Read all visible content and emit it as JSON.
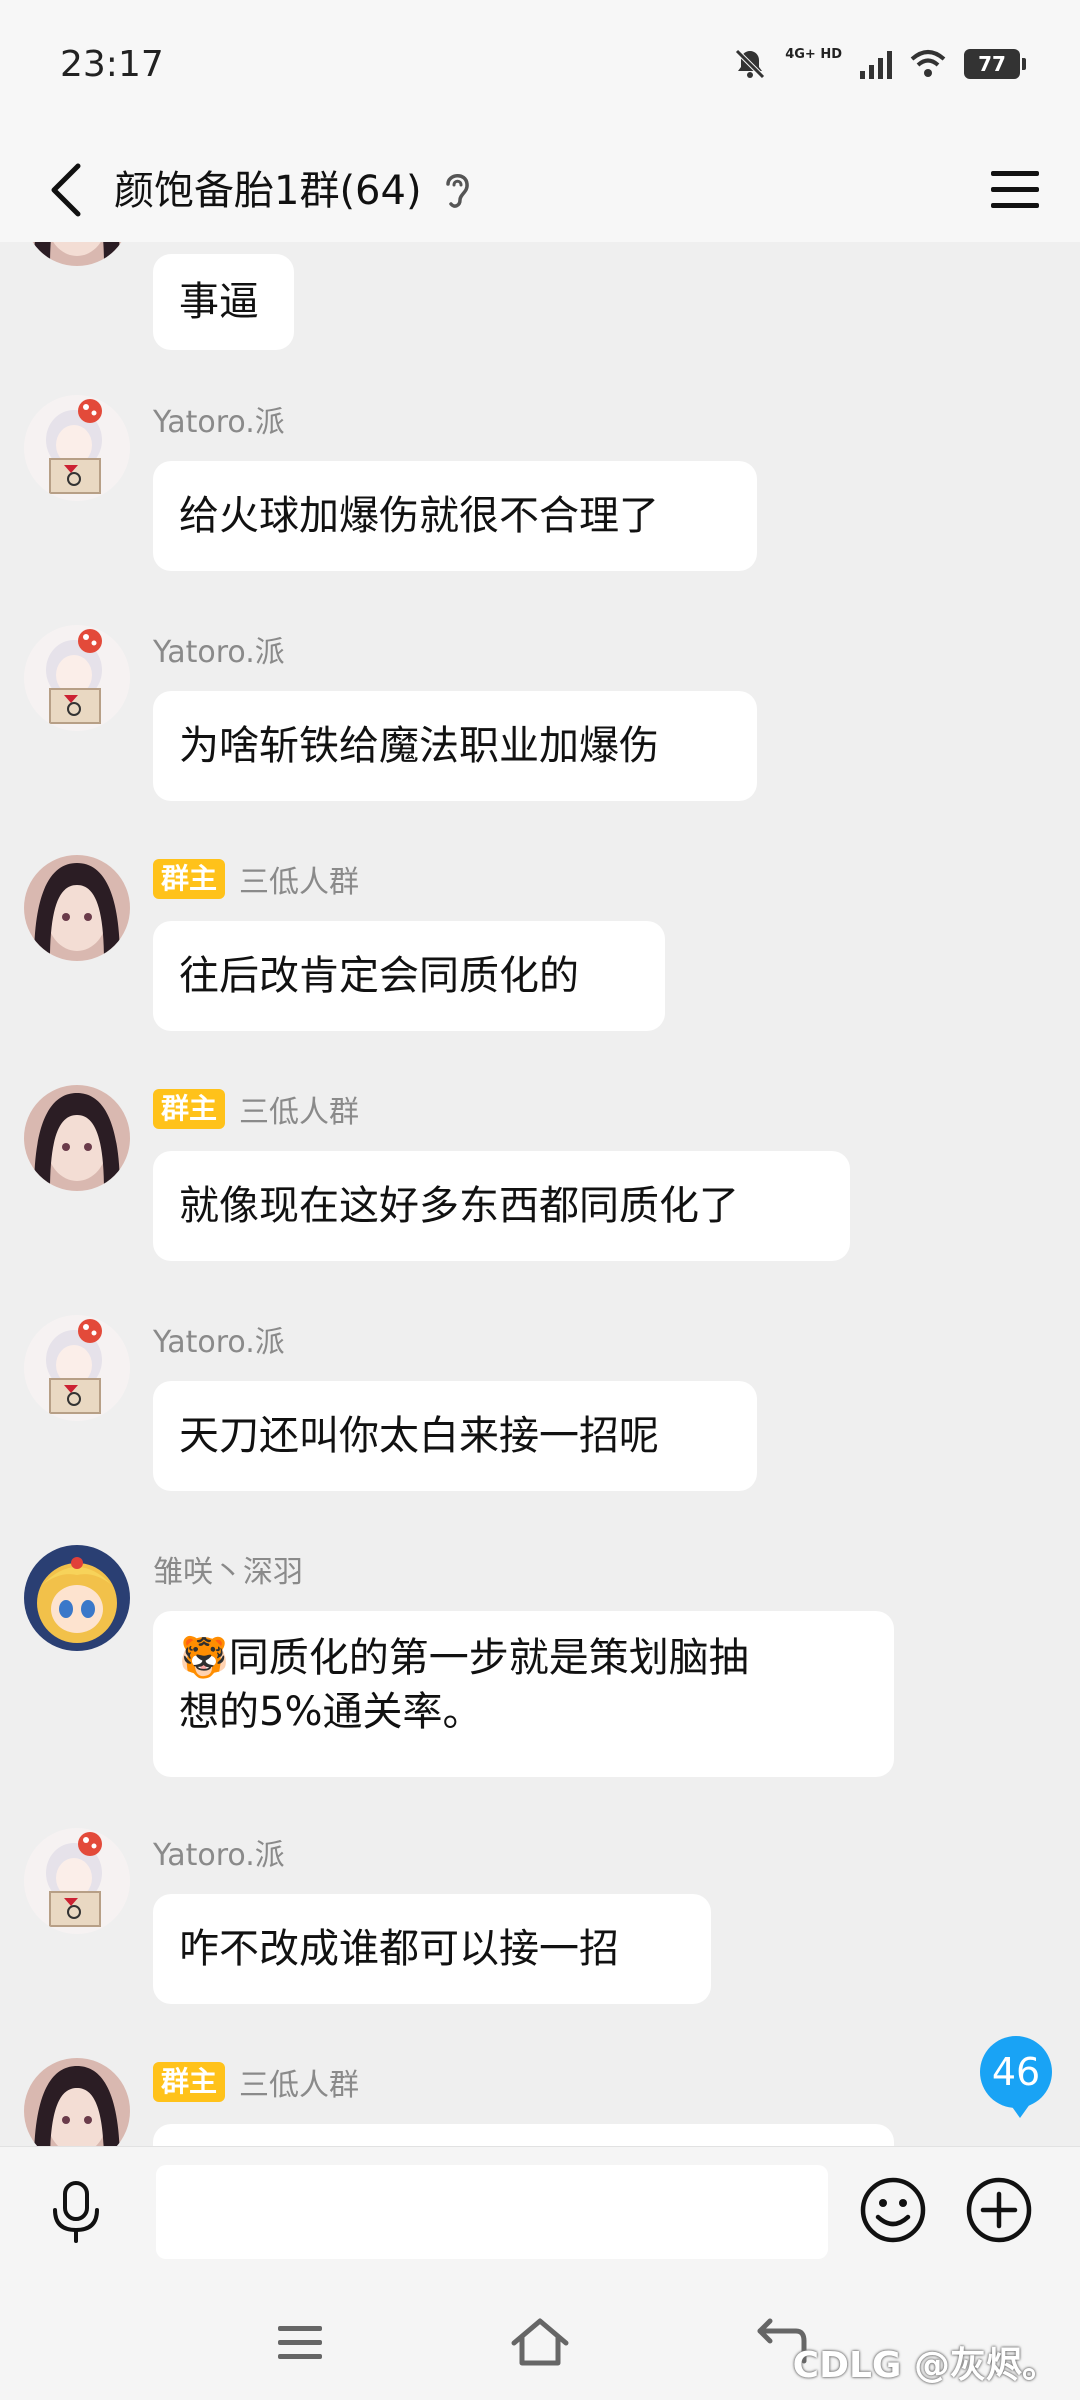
{
  "status_bar": {
    "time": "23:17",
    "network": "4G+ HD",
    "battery": "77"
  },
  "header": {
    "title": "颜饱备胎1群(64)"
  },
  "messages": [
    {
      "sender": "",
      "role_badge": "",
      "text": "事逼",
      "avatar": "avatar-girl-dark-hair"
    },
    {
      "sender": "Yatoro.派",
      "role_badge": "",
      "text": "给火球加爆伤就很不合理了",
      "avatar": "avatar-white-hair-mushroom"
    },
    {
      "sender": "Yatoro.派",
      "role_badge": "",
      "text": "为啥斩铁给魔法职业加爆伤",
      "avatar": "avatar-white-hair-mushroom"
    },
    {
      "sender": "三低人群",
      "role_badge": "群主",
      "text": "往后改肯定会同质化的",
      "avatar": "avatar-girl-dark-hair"
    },
    {
      "sender": "三低人群",
      "role_badge": "群主",
      "text": "就像现在这好多东西都同质化了",
      "avatar": "avatar-girl-dark-hair"
    },
    {
      "sender": "Yatoro.派",
      "role_badge": "",
      "text": "天刀还叫你太白来接一招呢",
      "avatar": "avatar-white-hair-mushroom"
    },
    {
      "sender": "雏咲丶深羽",
      "role_badge": "",
      "text_line1": "🐯同质化的第一步就是策划脑抽",
      "text_line2": "想的5%通关率。",
      "avatar": "avatar-blonde-chibi"
    },
    {
      "sender": "Yatoro.派",
      "role_badge": "",
      "text": "咋不改成谁都可以接一招",
      "avatar": "avatar-white-hair-mushroom"
    },
    {
      "sender": "三低人群",
      "role_badge": "群主",
      "text": "",
      "avatar": "avatar-girl-dark-hair"
    }
  ],
  "unread_count": "46",
  "input": {
    "placeholder": ""
  },
  "watermark": "CDLG @灰烬。",
  "colors": {
    "badge": "#ffc21a",
    "unread": "#19a3f5",
    "background": "#efefef"
  }
}
